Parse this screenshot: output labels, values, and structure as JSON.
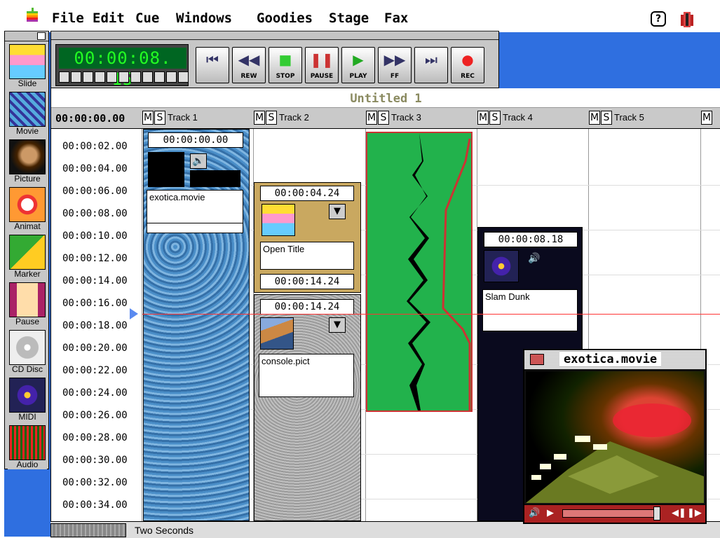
{
  "menubar": {
    "items": [
      "File",
      "Edit",
      "Cue",
      "Windows",
      "Goodies",
      "Stage",
      "Fax"
    ]
  },
  "palette": {
    "tools": [
      {
        "label": "Slide",
        "icon": "slide-icon"
      },
      {
        "label": "Movie",
        "icon": "movie-icon"
      },
      {
        "label": "Picture",
        "icon": "picture-icon"
      },
      {
        "label": "Animat",
        "icon": "animation-icon"
      },
      {
        "label": "Marker",
        "icon": "marker-icon"
      },
      {
        "label": "Pause",
        "icon": "hourglass-icon"
      },
      {
        "label": "CD Disc",
        "icon": "cd-icon"
      },
      {
        "label": "MIDI",
        "icon": "midi-icon"
      },
      {
        "label": "Audio",
        "icon": "audio-icon"
      }
    ]
  },
  "controls": {
    "clock": "00:00:08. 15",
    "buttons": [
      {
        "label": "",
        "glyph": "⏮",
        "icon": "rewind-to-start-icon"
      },
      {
        "label": "REW",
        "glyph": "◀◀",
        "icon": "rewind-icon"
      },
      {
        "label": "STOP",
        "glyph": "■",
        "icon": "stop-icon"
      },
      {
        "label": "PAUSE",
        "glyph": "❚❚",
        "icon": "pause-icon"
      },
      {
        "label": "PLAY",
        "glyph": "▶",
        "icon": "play-icon"
      },
      {
        "label": "FF",
        "glyph": "▶▶",
        "icon": "fast-forward-icon"
      },
      {
        "label": "",
        "glyph": "⏭",
        "icon": "skip-to-end-icon"
      },
      {
        "label": "REC",
        "glyph": "●",
        "icon": "record-icon"
      }
    ]
  },
  "sequence": {
    "title": "Untitled 1",
    "start_time": "00:00:00.00",
    "tracks": [
      "Track 1",
      "Track 2",
      "Track 3",
      "Track 4",
      "Track 5"
    ],
    "mute_label": "M",
    "solo_label": "S",
    "times": [
      "00:00:02.00",
      "00:00:04.00",
      "00:00:06.00",
      "00:00:08.00",
      "00:00:10.00",
      "00:00:12.00",
      "00:00:14.00",
      "00:00:16.00",
      "00:00:18.00",
      "00:00:20.00",
      "00:00:22.00",
      "00:00:24.00",
      "00:00:26.00",
      "00:00:28.00",
      "00:00:30.00",
      "00:00:32.00",
      "00:00:34.00"
    ],
    "cues": {
      "movie": {
        "start": "00:00:00.00",
        "name": "exotica.movie"
      },
      "title": {
        "start": "00:00:04.24",
        "name": "Open Title",
        "end": "00:00:14.24"
      },
      "pict": {
        "start": "00:00:14.24",
        "name": "console.pict"
      },
      "midi": {
        "start": "00:00:08.18",
        "name": "Slam Dunk"
      }
    }
  },
  "footer": {
    "zoom": "Two Seconds"
  },
  "movie_window": {
    "title": "exotica.movie"
  },
  "colors": {
    "desktop": "#2f6fe0",
    "audio_track": "#22b24c",
    "playhead": "#ff3333",
    "clock": "#22ff22"
  }
}
